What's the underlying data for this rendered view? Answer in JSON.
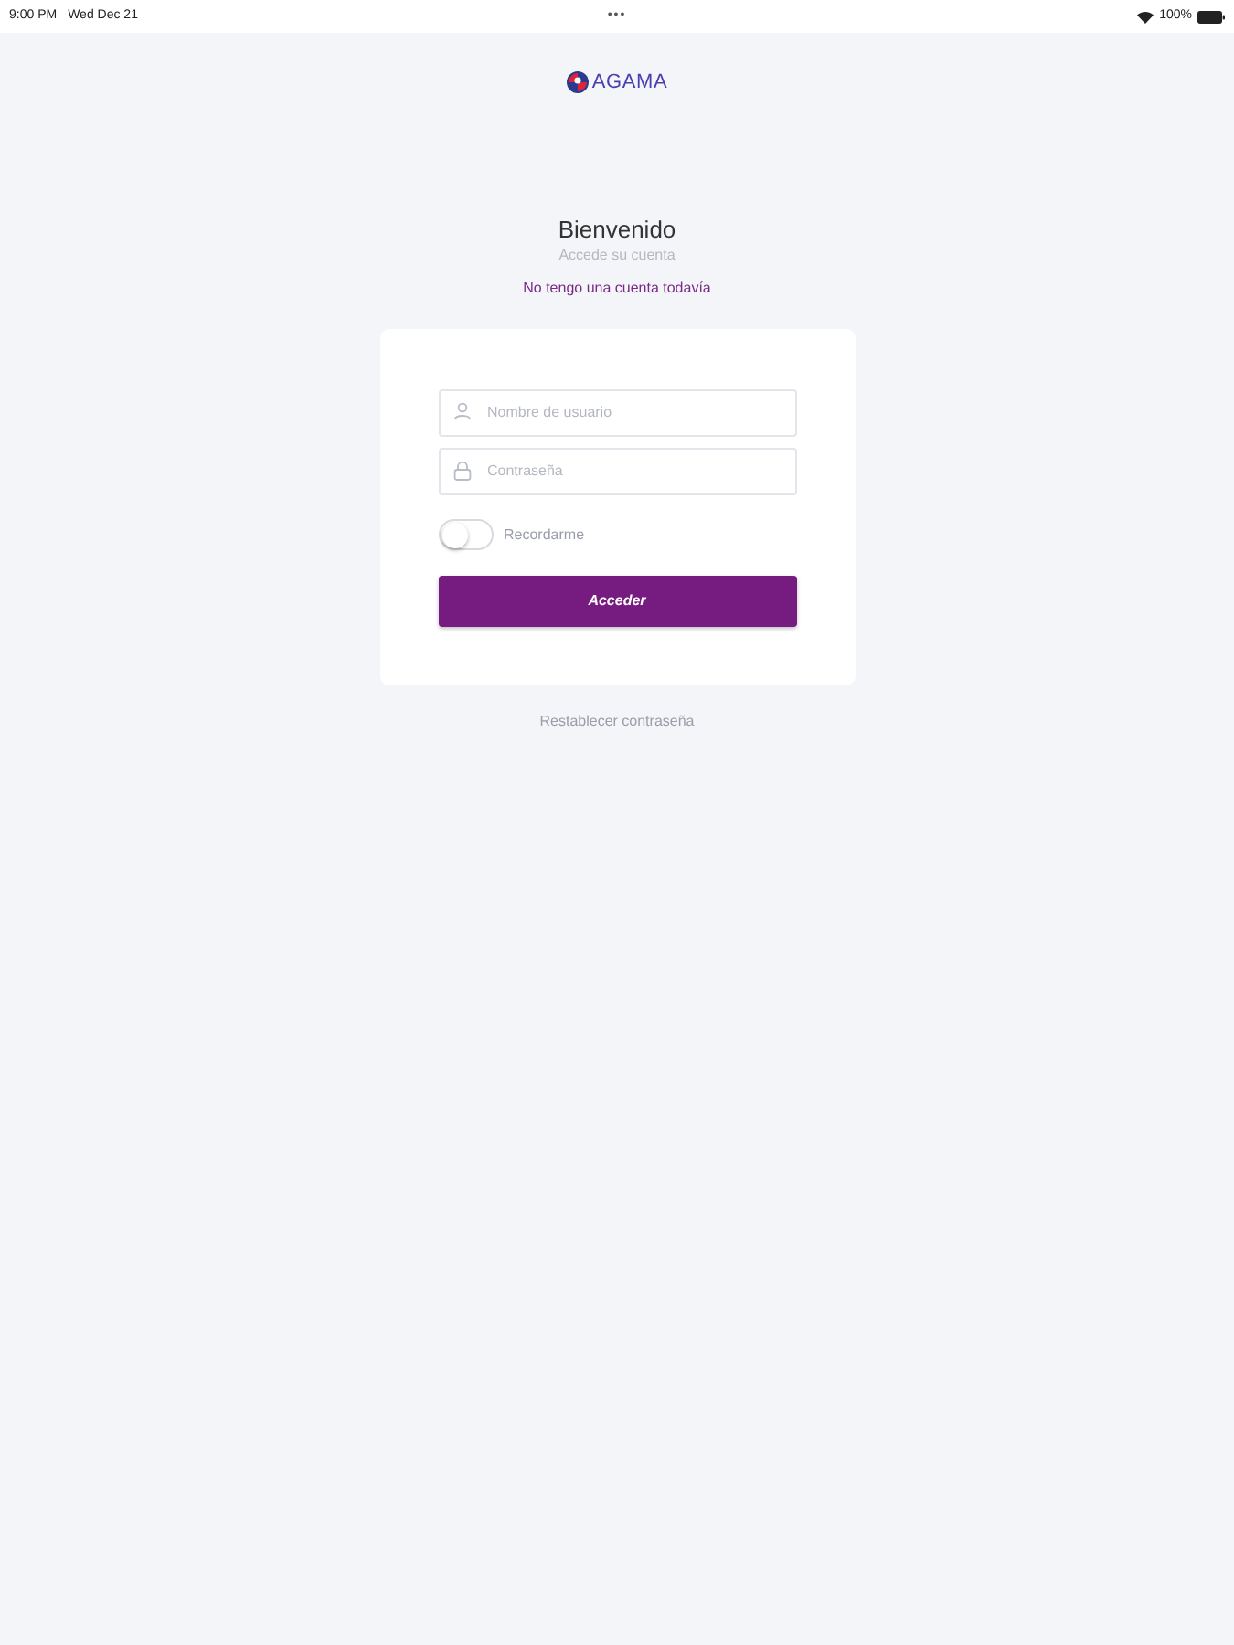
{
  "status_bar": {
    "time": "9:00 PM",
    "date": "Wed Dec 21",
    "dots": "•••",
    "battery_text": "100%"
  },
  "logo": {
    "text": "AGAMA"
  },
  "header": {
    "title": "Bienvenido",
    "subtitle": "Accede su cuenta",
    "signup_link": "No tengo una cuenta todavía"
  },
  "form": {
    "fields": [
      {
        "kind": "user",
        "placeholder": "Nombre de usuario"
      },
      {
        "kind": "lock",
        "placeholder": "Contraseña"
      }
    ],
    "remember": {
      "label": "Recordarme",
      "on": false
    },
    "submit": "Acceder"
  },
  "reset_link": "Restablecer contraseña"
}
